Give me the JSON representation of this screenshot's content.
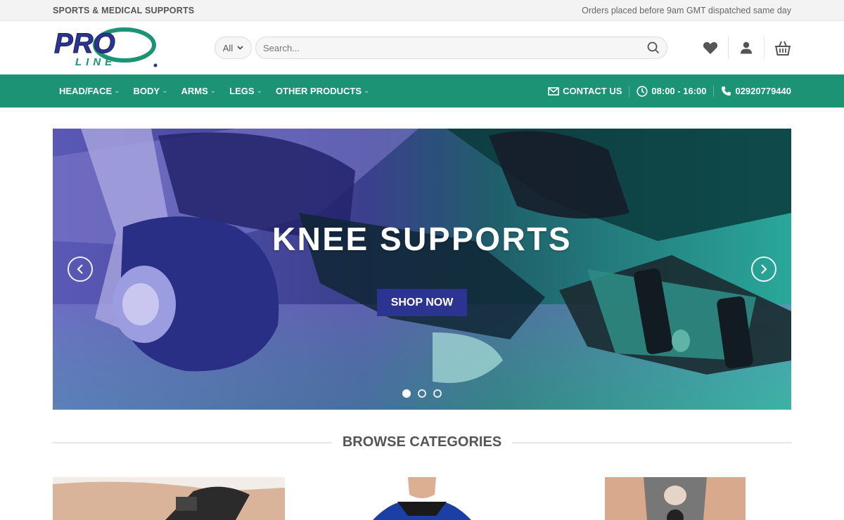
{
  "topbar": {
    "left_text": "SPORTS & MEDICAL SUPPORTS",
    "right_text": "Orders placed before 9am GMT dispatched same day"
  },
  "logo": {
    "text_top": "PRO",
    "text_bottom": "LINE"
  },
  "search": {
    "category_label": "All",
    "placeholder": "Search..."
  },
  "header_icons": [
    "heart-icon",
    "user-icon",
    "basket-icon"
  ],
  "nav": {
    "items": [
      {
        "label": "HEAD/FACE"
      },
      {
        "label": "BODY"
      },
      {
        "label": "ARMS"
      },
      {
        "label": "LEGS"
      },
      {
        "label": "OTHER PRODUCTS"
      }
    ],
    "contact_label": "CONTACT US",
    "hours": "08:00 - 16:00",
    "phone": "02920779440"
  },
  "hero": {
    "title": "KNEE SUPPORTS",
    "button_label": "SHOP NOW",
    "slide_count": 3,
    "active_slide": 1
  },
  "browse": {
    "title": "BROWSE CATEGORIES"
  },
  "colors": {
    "nav_bg": "#1b9374",
    "button_bg": "#2b3491",
    "logo_blue": "#2b3491",
    "logo_green": "#1b9374"
  }
}
